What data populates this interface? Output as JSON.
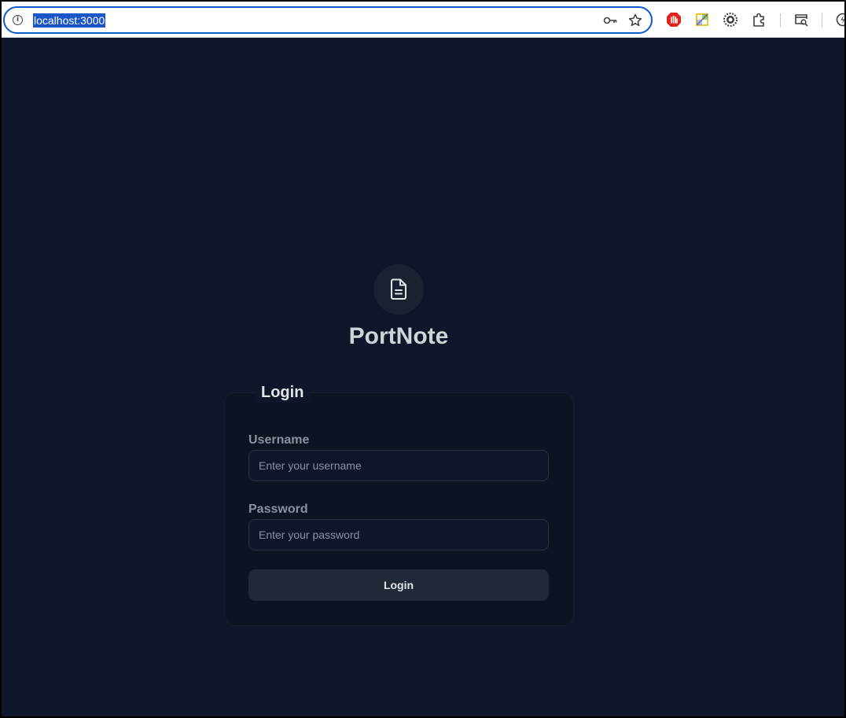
{
  "browser": {
    "url": "localhost:3000"
  },
  "app": {
    "title": "PortNote",
    "logo_icon": "file-text-icon"
  },
  "login_form": {
    "title": "Login",
    "username_label": "Username",
    "username_placeholder": "Enter your username",
    "password_label": "Password",
    "password_placeholder": "Enter your password",
    "submit_label": "Login"
  },
  "colors": {
    "background": "#0f1629",
    "card": "#0c1322",
    "button": "#1f2937",
    "accent_focus": "#0b57d0"
  }
}
